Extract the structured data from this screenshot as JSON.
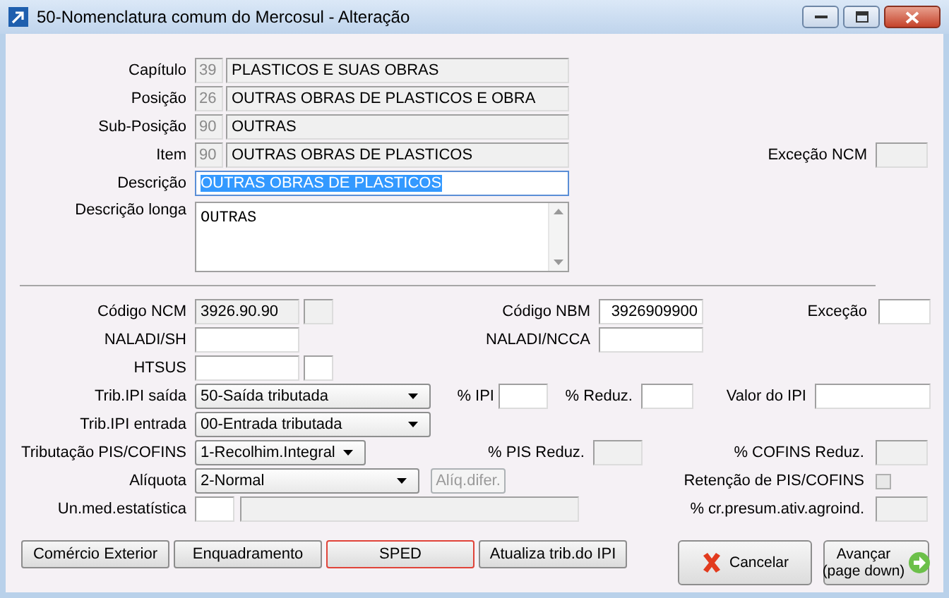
{
  "window": {
    "title": "50-Nomenclatura comum do Mercosul - Alteração"
  },
  "header_fields": [
    {
      "label": "Capítulo",
      "code": "39",
      "name": "PLASTICOS E SUAS OBRAS"
    },
    {
      "label": "Posição",
      "code": "26",
      "name": "OUTRAS OBRAS DE PLASTICOS E OBRA"
    },
    {
      "label": "Sub-Posição",
      "code": "90",
      "name": "OUTRAS"
    },
    {
      "label": "Item",
      "code": "90",
      "name": "OUTRAS OBRAS DE PLASTICOS"
    }
  ],
  "excecao_ncm": {
    "label": "Exceção NCM",
    "disabled": true
  },
  "descricao": {
    "label": "Descrição",
    "value": "OUTRAS OBRAS DE PLASTICOS",
    "text_selected": true
  },
  "descricao_longa": {
    "label": "Descrição longa",
    "value": "OUTRAS"
  },
  "codigo_ncm": {
    "label": "Código NCM",
    "value": "3926.90.90",
    "suffix_disabled": true
  },
  "codigo_nbm": {
    "label": "Código NBM",
    "value": "3926909900"
  },
  "excecao": {
    "label": "Exceção"
  },
  "naladi_sh": {
    "label": "NALADI/SH"
  },
  "naladi_ncca": {
    "label": "NALADI/NCCA"
  },
  "htsus": {
    "label": "HTSUS"
  },
  "trib_ipi_saida": {
    "label": "Trib.IPI saída",
    "value": "50-Saída tributada"
  },
  "pct_ipi": {
    "label": "% IPI"
  },
  "pct_reduz": {
    "label": "% Reduz."
  },
  "valor_ipi": {
    "label": "Valor do IPI"
  },
  "trib_ipi_entrada": {
    "label": "Trib.IPI entrada",
    "value": "00-Entrada tributada"
  },
  "trib_pis_cofins": {
    "label": "Tributação PIS/COFINS",
    "value": "1-Recolhim.Integral"
  },
  "pct_pis_reduz": {
    "label": "% PIS Reduz.",
    "disabled": true
  },
  "pct_cofins_reduz": {
    "label": "% COFINS Reduz.",
    "disabled": true
  },
  "aliquota": {
    "label": "Alíquota",
    "value": "2-Normal"
  },
  "aliq_difer": {
    "label": "Alíq.difer.",
    "disabled": true
  },
  "retencao": {
    "label": "Retenção de PIS/COFINS",
    "checked": false,
    "disabled": true
  },
  "un_med": {
    "label": "Un.med.estatística",
    "detail_disabled": true
  },
  "cr_presum": {
    "label": "% cr.presum.ativ.agroind.",
    "disabled": true
  },
  "tab_buttons": [
    {
      "label": "Comércio Exterior",
      "focused": false
    },
    {
      "label": "Enquadramento",
      "focused": false
    },
    {
      "label": "SPED",
      "focused": true
    },
    {
      "label": "Atualiza trib.do IPI",
      "focused": false
    }
  ],
  "action_buttons": [
    {
      "kind": "cancel",
      "lines": [
        "Cancelar"
      ]
    },
    {
      "kind": "next",
      "lines": [
        "Avançar",
        "(page down)"
      ]
    }
  ]
}
